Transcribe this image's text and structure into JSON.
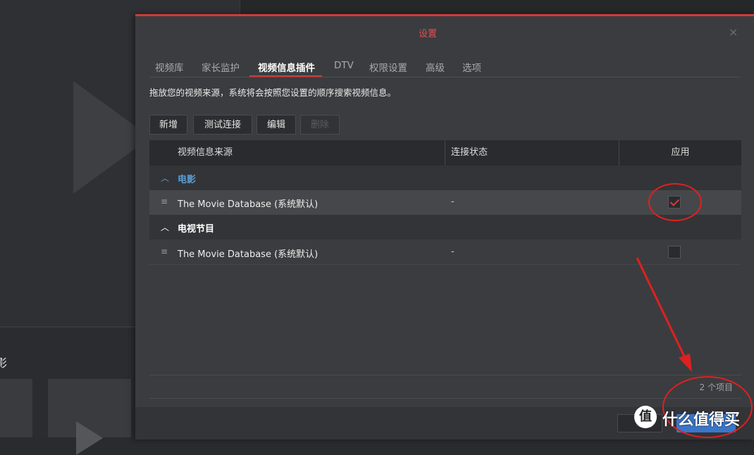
{
  "background": {
    "section_char": "影"
  },
  "dialog": {
    "title": "设置",
    "close_glyph": "×",
    "tabs": [
      {
        "label": "视频库"
      },
      {
        "label": "家长监护"
      },
      {
        "label": "视频信息插件",
        "active": true
      },
      {
        "label": "DTV"
      },
      {
        "label": "权限设置"
      },
      {
        "label": "高级"
      },
      {
        "label": "选项"
      }
    ],
    "description": "拖放您的视频来源，系统将会按照您设置的顺序搜索视频信息。",
    "toolbar": {
      "add_label": "新增",
      "test_label": "测试连接",
      "edit_label": "编辑",
      "delete_label": "删除"
    },
    "table": {
      "columns": [
        "视频信息来源",
        "连接状态",
        "应用"
      ],
      "groups": [
        {
          "label": "电影",
          "caret": "︿",
          "color": "#5a9fd8",
          "rows": [
            {
              "source": "The Movie Database (系统默认)",
              "status": "-",
              "applied": true
            }
          ]
        },
        {
          "label": "电视节目",
          "caret": "︿",
          "color": "#ffffff",
          "rows": [
            {
              "source": "The Movie Database (系统默认)",
              "status": "-",
              "applied": false
            }
          ]
        }
      ],
      "drag_glyph": "≡"
    },
    "item_count": "2 个项目"
  },
  "colors": {
    "accent_red": "#d23a3a",
    "group_blue": "#5a9fd8"
  },
  "watermark": {
    "logo_char": "值",
    "text": "什么值得买"
  }
}
